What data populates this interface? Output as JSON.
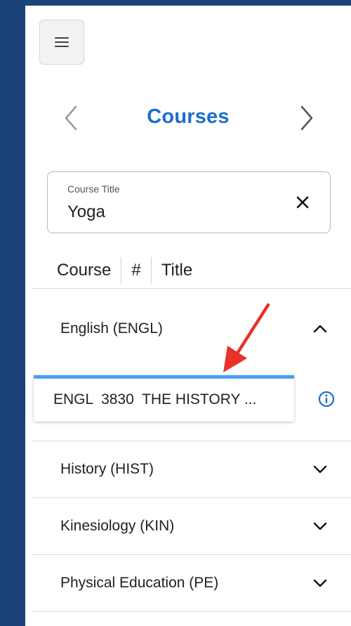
{
  "header": {
    "title": "Courses"
  },
  "search": {
    "label": "Course Title",
    "value": "Yoga"
  },
  "columns": [
    "Course",
    "#",
    "Title"
  ],
  "subjects": [
    {
      "label": "English (ENGL)",
      "expanded": true
    },
    {
      "label": "History (HIST)",
      "expanded": false
    },
    {
      "label": "Kinesiology (KIN)",
      "expanded": false
    },
    {
      "label": "Physical Education (PE)",
      "expanded": false
    }
  ],
  "course_result": {
    "text": "ENGL  3830  THE HISTORY ..."
  },
  "colors": {
    "accent": "#1a6fc9",
    "background": "#1b4279",
    "card_top": "#4a9ff5",
    "annotation_arrow": "#e8322a"
  },
  "icons": {
    "menu": "hamburger-icon",
    "prev": "chevron-left-icon",
    "next": "chevron-right-icon",
    "clear": "close-icon",
    "expand": "chevron-down-icon",
    "collapse": "chevron-up-icon",
    "info": "info-icon"
  }
}
